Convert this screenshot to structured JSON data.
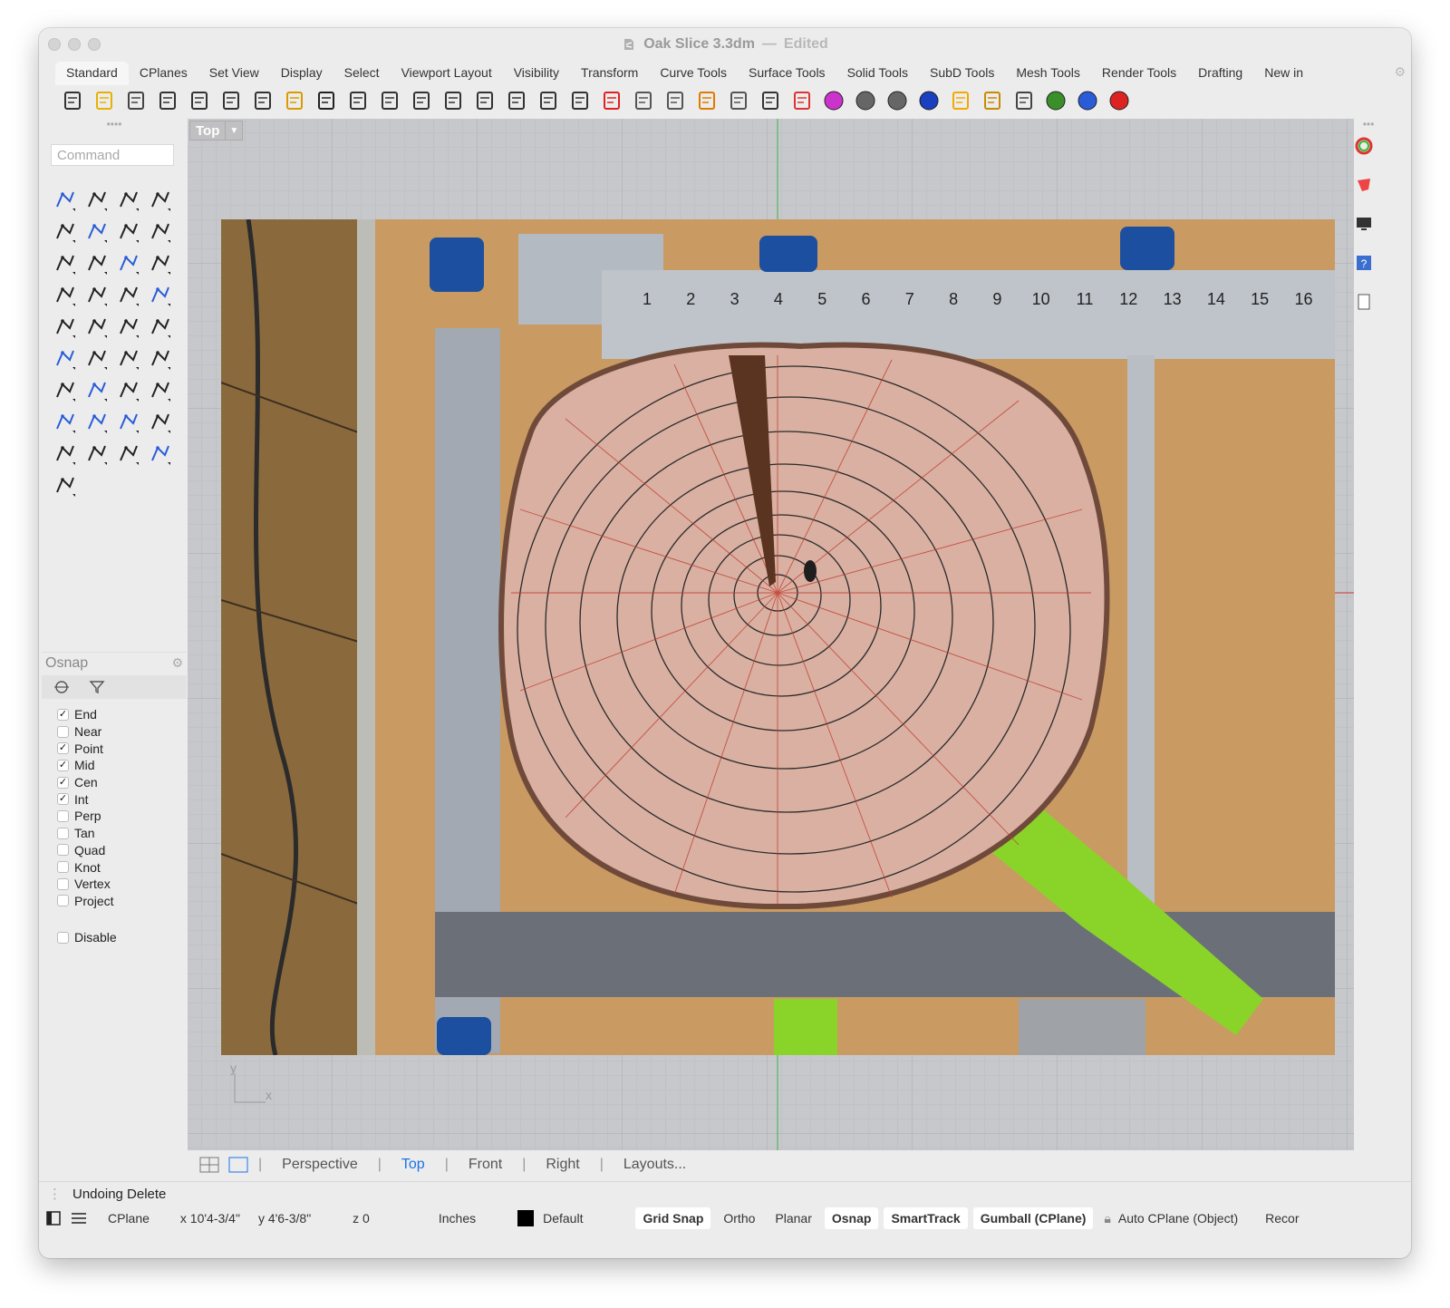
{
  "window": {
    "title": "Oak Slice 3.3dm",
    "title_sep": "—",
    "title_state": "Edited"
  },
  "tabs": [
    "Standard",
    "CPlanes",
    "Set View",
    "Display",
    "Select",
    "Viewport Layout",
    "Visibility",
    "Transform",
    "Curve Tools",
    "Surface Tools",
    "Solid Tools",
    "SubD Tools",
    "Mesh Tools",
    "Render Tools",
    "Drafting",
    "New in"
  ],
  "toolbar_icons": [
    "new-file-icon",
    "open-folder-icon",
    "save-icon",
    "print-icon",
    "import-icon",
    "cut-icon",
    "copy-icon",
    "paste-icon",
    "undo-icon",
    "pan-hand-icon",
    "rotate-view-icon",
    "zoom-icon",
    "zoom-window-icon",
    "zoom-extents-icon",
    "zoom-selected-icon",
    "rotate-camera-icon",
    "four-viewports-icon",
    "car-icon",
    "grid-plane-icon",
    "cplane-icon",
    "snap-icon",
    "lightbulb-icon",
    "lock-icon",
    "shield-icon",
    "color-wheel-icon",
    "sphere-shaded-icon",
    "sphere-wire-icon",
    "sphere-blue-icon",
    "spotlight-icon",
    "gear-settings-icon",
    "dimension-icon",
    "globe-icon",
    "help-icon",
    "chat-icon"
  ],
  "command": {
    "placeholder": "Command"
  },
  "left_tools": [
    "select-arrow-icon",
    "point-icon",
    "polyline-icon",
    "curve-icon",
    "circle-icon",
    "ellipse-icon",
    "arc-icon",
    "rectangle-icon",
    "polygon-icon",
    "fillet-curve-icon",
    "surface-icon",
    "loft-icon",
    "box-icon",
    "boolean-icon",
    "cylinder-icon",
    "plane-surface-icon",
    "explode-icon",
    "split-icon",
    "move-icon",
    "project-icon",
    "group-icon",
    "points-icon",
    "rotate-icon",
    "sweep-icon",
    "text-icon",
    "scale-icon",
    "array-icon",
    "edit-icon",
    "solid-box-icon",
    "extrude-icon",
    "grid-array-icon",
    "dimension-tool-icon",
    "history-icon",
    "gumball-icon",
    "check-icon",
    "mesh-icon",
    "paint-icon"
  ],
  "osnap": {
    "title": "Osnap",
    "items": [
      {
        "label": "End",
        "checked": true
      },
      {
        "label": "Near",
        "checked": false
      },
      {
        "label": "Point",
        "checked": true
      },
      {
        "label": "Mid",
        "checked": true
      },
      {
        "label": "Cen",
        "checked": true
      },
      {
        "label": "Int",
        "checked": true
      },
      {
        "label": "Perp",
        "checked": false
      },
      {
        "label": "Tan",
        "checked": false
      },
      {
        "label": "Quad",
        "checked": false
      },
      {
        "label": "Knot",
        "checked": false
      },
      {
        "label": "Vertex",
        "checked": false
      },
      {
        "label": "Project",
        "checked": false
      }
    ],
    "disable": {
      "label": "Disable",
      "checked": false
    }
  },
  "viewport": {
    "label": "Top",
    "axis_x": "x",
    "axis_y": "y"
  },
  "ruler_top": [
    "1",
    "2",
    "3",
    "4",
    "5",
    "6",
    "7",
    "8",
    "9",
    "10",
    "11",
    "12",
    "13",
    "14",
    "15",
    "16"
  ],
  "view_tabs": [
    "Perspective",
    "Top",
    "Front",
    "Right",
    "Layouts..."
  ],
  "active_view": "Top",
  "status": {
    "message": "Undoing Delete",
    "cplane": "CPlane",
    "x": "x 10'4-3/4\"",
    "y": "y 4'6-3/8\"",
    "z": "z 0",
    "units": "Inches",
    "layer": "Default",
    "toggles": [
      {
        "label": "Grid Snap",
        "on": true
      },
      {
        "label": "Ortho",
        "on": false
      },
      {
        "label": "Planar",
        "on": false
      },
      {
        "label": "Osnap",
        "on": true
      },
      {
        "label": "SmartTrack",
        "on": true
      },
      {
        "label": "Gumball (CPlane)",
        "on": true
      }
    ],
    "auto_cplane": "Auto CPlane (Object)",
    "record": "Recor"
  },
  "colors": {
    "accent": "#1a73e8",
    "viewport_bg": "#c7c8cc",
    "wood": "#d9b0a2",
    "board": "#c99a62"
  }
}
